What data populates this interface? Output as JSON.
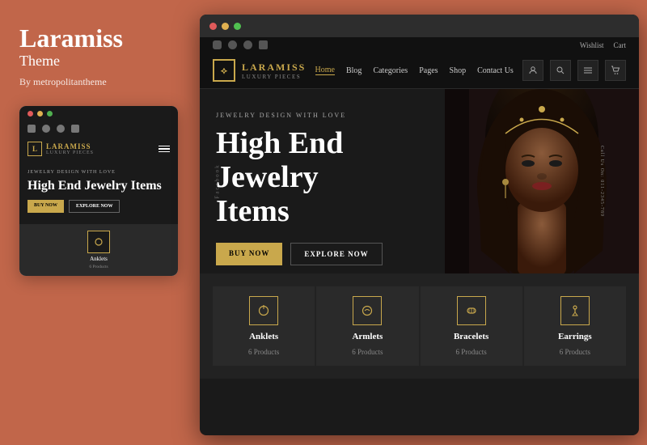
{
  "left_panel": {
    "brand_name": "Laramiss",
    "brand_subtitle": "Theme",
    "brand_by": "By metropolitantheme"
  },
  "mobile_preview": {
    "topbar_dots": [
      "red",
      "yellow",
      "green"
    ],
    "social_icons": [
      "facebook",
      "twitter",
      "pinterest",
      "linkedin"
    ],
    "nav": {
      "logo_name": "LARAMISS",
      "logo_sub": "LUXURY PIECES"
    },
    "hero": {
      "eyebrow": "JEWELRY DESIGN WITH LOVE",
      "title": "High End Jewelry Items",
      "btn_primary": "BUY NOW",
      "btn_secondary": "EXPLORE NOW"
    },
    "category": {
      "label": "Anklets",
      "count": "6 Products"
    }
  },
  "browser": {
    "social_links": [
      "facebook",
      "twitter",
      "pinterest",
      "linkedin"
    ],
    "nav_right": [
      "Wishlist",
      "Cart"
    ],
    "logo_name": "LARAMISS",
    "logo_sub": "LUXURY PIECES",
    "nav_links": [
      {
        "label": "Home",
        "active": true
      },
      {
        "label": "Blog",
        "active": false
      },
      {
        "label": "Categories",
        "active": false
      },
      {
        "label": "Pages",
        "active": false
      },
      {
        "label": "Shop",
        "active": false
      },
      {
        "label": "Contact Us",
        "active": false
      }
    ],
    "hero": {
      "eyebrow": "JEWELRY DESIGN WITH LOVE",
      "title_line1": "High End",
      "title_line2": "Jewelry",
      "title_line3": "Items",
      "btn_primary": "BUY NOW",
      "btn_secondary": "EXPLORE NOW",
      "side_text": "Call Us On: 011-2345-789",
      "left_text": "Facebook"
    },
    "categories": [
      {
        "name": "Anklets",
        "count": "6 Products",
        "icon": "anklets"
      },
      {
        "name": "Armlets",
        "count": "6 Products",
        "icon": "armlets"
      },
      {
        "name": "Bracelets",
        "count": "6 Products",
        "icon": "bracelets"
      },
      {
        "name": "Earrings",
        "count": "6 Products",
        "icon": "earrings"
      }
    ]
  }
}
